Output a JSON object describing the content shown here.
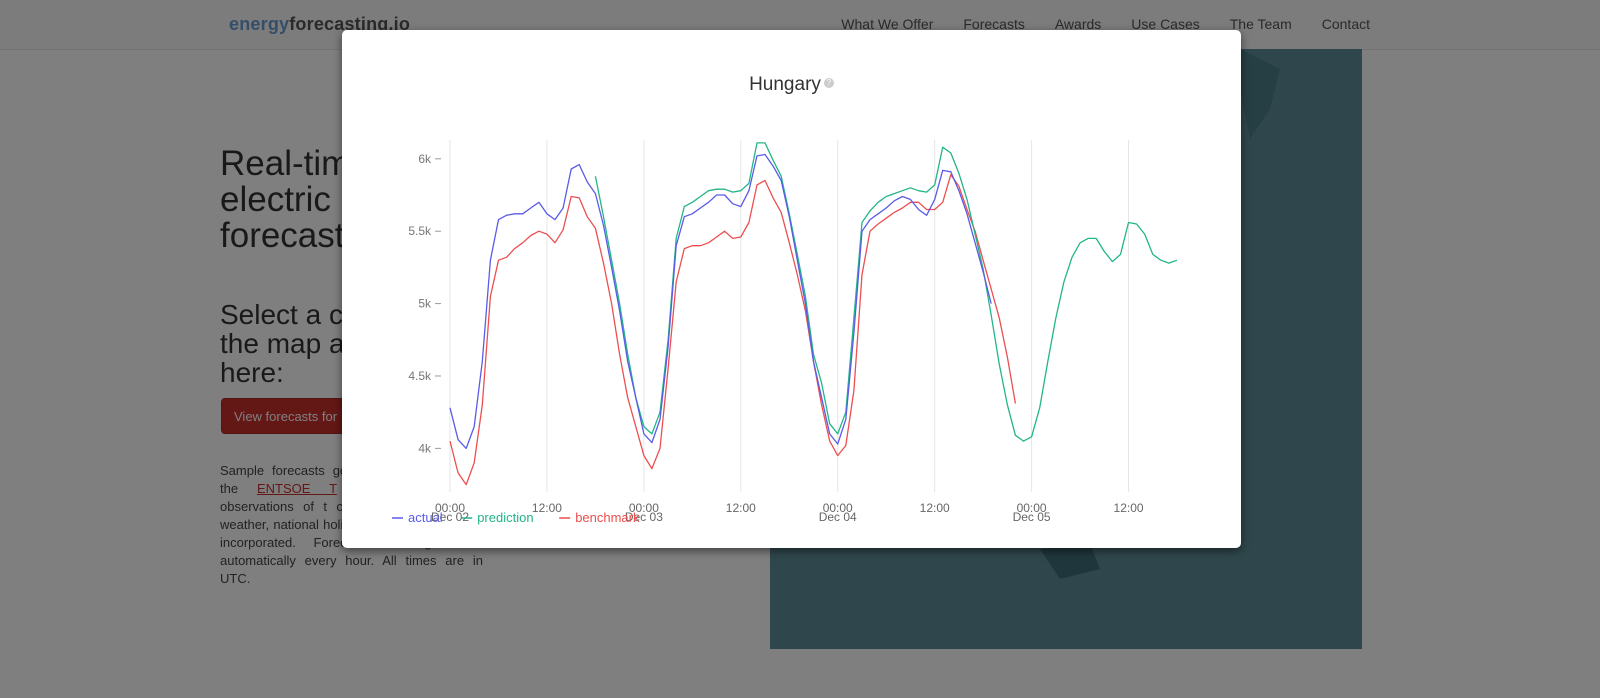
{
  "brand": {
    "part1": "energy",
    "part2": "forecasting.io"
  },
  "nav": [
    "What We Offer",
    "Forecasts",
    "Awards",
    "Use Cases",
    "The Team",
    "Contact"
  ],
  "hero": {
    "line1": "Real-tim",
    "line2": "electric",
    "line3": "forecast"
  },
  "select": {
    "line1": "Select a co",
    "line2": "the map a",
    "line3": "here:"
  },
  "view_button": "View forecasts for",
  "description": {
    "before_link": "Sample forecasts generated on publi from the",
    "link": "ENTSOE T",
    "after_link": "These models ar observations of t calendar data only. No weather, national holiday or economic data is incorporated. Forecasts are generated automatically every hour. All times are in UTC."
  },
  "colors": {
    "actual": "#5b5be8",
    "prediction": "#22b58a",
    "benchmark": "#ec4f4f",
    "map": "#5e8e99"
  },
  "chart_data": {
    "type": "line",
    "title": "Hungary",
    "x_tick_labels": [
      {
        "label": "00:00",
        "sub": "Dec 02",
        "hour": 0
      },
      {
        "label": "12:00",
        "sub": "",
        "hour": 12
      },
      {
        "label": "00:00",
        "sub": "Dec 03",
        "hour": 24
      },
      {
        "label": "12:00",
        "sub": "",
        "hour": 36
      },
      {
        "label": "00:00",
        "sub": "Dec 04",
        "hour": 48
      },
      {
        "label": "12:00",
        "sub": "",
        "hour": 60
      },
      {
        "label": "00:00",
        "sub": "Dec 05",
        "hour": 72
      },
      {
        "label": "12:00",
        "sub": "",
        "hour": 84
      }
    ],
    "y_ticks": [
      4000,
      4500,
      5000,
      5500,
      6000
    ],
    "y_tick_labels": [
      "4k",
      "4.5k",
      "5k",
      "5.5k",
      "6k"
    ],
    "ylim": [
      3740,
      6130
    ],
    "xlim": [
      0,
      90
    ],
    "legend": "bottom-left",
    "series": [
      {
        "name": "actual",
        "x": [
          0,
          1,
          2,
          3,
          4,
          5,
          6,
          7,
          8,
          9,
          10,
          11,
          12,
          13,
          14,
          15,
          16,
          17,
          18,
          19,
          20,
          21,
          22,
          23,
          24,
          25,
          26,
          27,
          28,
          29,
          30,
          31,
          32,
          33,
          34,
          35,
          36,
          37,
          38,
          39,
          40,
          41,
          42,
          43,
          44,
          45,
          46,
          47,
          48,
          49,
          50,
          51,
          52,
          53,
          54,
          55,
          56,
          57,
          58,
          59,
          60,
          61,
          62,
          63,
          64,
          65,
          66,
          67
        ],
        "y": [
          4280,
          4060,
          4000,
          4150,
          4600,
          5300,
          5580,
          5610,
          5620,
          5620,
          5660,
          5700,
          5620,
          5580,
          5660,
          5930,
          5960,
          5840,
          5760,
          5540,
          5250,
          4950,
          4600,
          4350,
          4100,
          4040,
          4200,
          4700,
          5400,
          5600,
          5620,
          5660,
          5700,
          5750,
          5750,
          5690,
          5670,
          5780,
          6020,
          6030,
          5950,
          5850,
          5600,
          5300,
          5000,
          4600,
          4350,
          4100,
          4030,
          4200,
          4800,
          5500,
          5580,
          5620,
          5660,
          5710,
          5740,
          5720,
          5650,
          5610,
          5720,
          5920,
          5910,
          5780,
          5620,
          5420,
          5220,
          5000
        ]
      },
      {
        "name": "prediction",
        "x": [
          18,
          19,
          20,
          21,
          22,
          23,
          24,
          25,
          26,
          27,
          28,
          29,
          30,
          31,
          32,
          33,
          34,
          35,
          36,
          37,
          38,
          39,
          40,
          41,
          42,
          43,
          44,
          45,
          46,
          47,
          48,
          49,
          50,
          51,
          52,
          53,
          54,
          55,
          56,
          57,
          58,
          59,
          60,
          61,
          62,
          63,
          64,
          65,
          66,
          67,
          68,
          69,
          70,
          71,
          72,
          73,
          74,
          75,
          76,
          77,
          78,
          79,
          80,
          81,
          82,
          83,
          84,
          85,
          86,
          87,
          88,
          89,
          90
        ],
        "y": [
          5880,
          5600,
          5300,
          5000,
          4650,
          4350,
          4150,
          4100,
          4250,
          4750,
          5450,
          5670,
          5700,
          5740,
          5780,
          5790,
          5790,
          5770,
          5780,
          5830,
          6110,
          6110,
          5990,
          5880,
          5620,
          5340,
          5050,
          4650,
          4450,
          4170,
          4100,
          4250,
          4900,
          5560,
          5640,
          5700,
          5740,
          5760,
          5780,
          5800,
          5780,
          5770,
          5820,
          6080,
          6040,
          5900,
          5720,
          5480,
          5240,
          4920,
          4580,
          4300,
          4090,
          4050,
          4080,
          4280,
          4600,
          4900,
          5150,
          5320,
          5420,
          5450,
          5450,
          5360,
          5290,
          5340,
          5560,
          5550,
          5480,
          5340,
          5300,
          5280,
          5300
        ]
      },
      {
        "name": "benchmark",
        "x": [
          0,
          1,
          2,
          3,
          4,
          5,
          6,
          7,
          8,
          9,
          10,
          11,
          12,
          13,
          14,
          15,
          16,
          17,
          18,
          19,
          20,
          21,
          22,
          23,
          24,
          25,
          26,
          27,
          28,
          29,
          30,
          31,
          32,
          33,
          34,
          35,
          36,
          37,
          38,
          39,
          40,
          41,
          42,
          43,
          44,
          45,
          46,
          47,
          48,
          49,
          50,
          51,
          52,
          53,
          54,
          55,
          56,
          57,
          58,
          59,
          60,
          61,
          62,
          63,
          64,
          65,
          66,
          67,
          68,
          69,
          70
        ],
        "y": [
          4050,
          3830,
          3750,
          3900,
          4300,
          5050,
          5300,
          5320,
          5380,
          5420,
          5470,
          5500,
          5480,
          5420,
          5510,
          5740,
          5730,
          5600,
          5520,
          5280,
          5000,
          4650,
          4350,
          4150,
          3950,
          3860,
          4000,
          4550,
          5150,
          5380,
          5400,
          5400,
          5420,
          5460,
          5500,
          5450,
          5460,
          5560,
          5820,
          5850,
          5730,
          5630,
          5420,
          5200,
          4950,
          4600,
          4300,
          4050,
          3950,
          4020,
          4400,
          5200,
          5500,
          5550,
          5590,
          5630,
          5660,
          5700,
          5700,
          5650,
          5650,
          5700,
          5890,
          5810,
          5650,
          5500,
          5300,
          5100,
          4900,
          4630,
          4310
        ]
      }
    ]
  }
}
